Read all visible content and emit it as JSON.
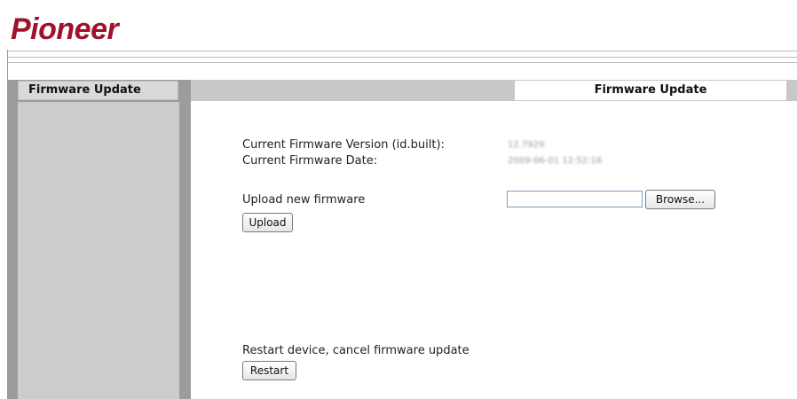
{
  "brand": {
    "logo_text": "Pioneer",
    "accent": "#a0112c"
  },
  "nav": {
    "header": "Firmware Update"
  },
  "tab": {
    "label": "Firmware Update"
  },
  "firmware": {
    "version_label": "Current Firmware Version (id.built):",
    "version_value": "12.7929",
    "date_label": "Current Firmware Date:",
    "date_value": "2009-06-01 12:52:16"
  },
  "upload": {
    "label": "Upload new firmware",
    "file_value": "",
    "browse_label": "Browse...",
    "upload_label": "Upload"
  },
  "restart": {
    "label": "Restart device, cancel firmware update",
    "button_label": "Restart"
  }
}
